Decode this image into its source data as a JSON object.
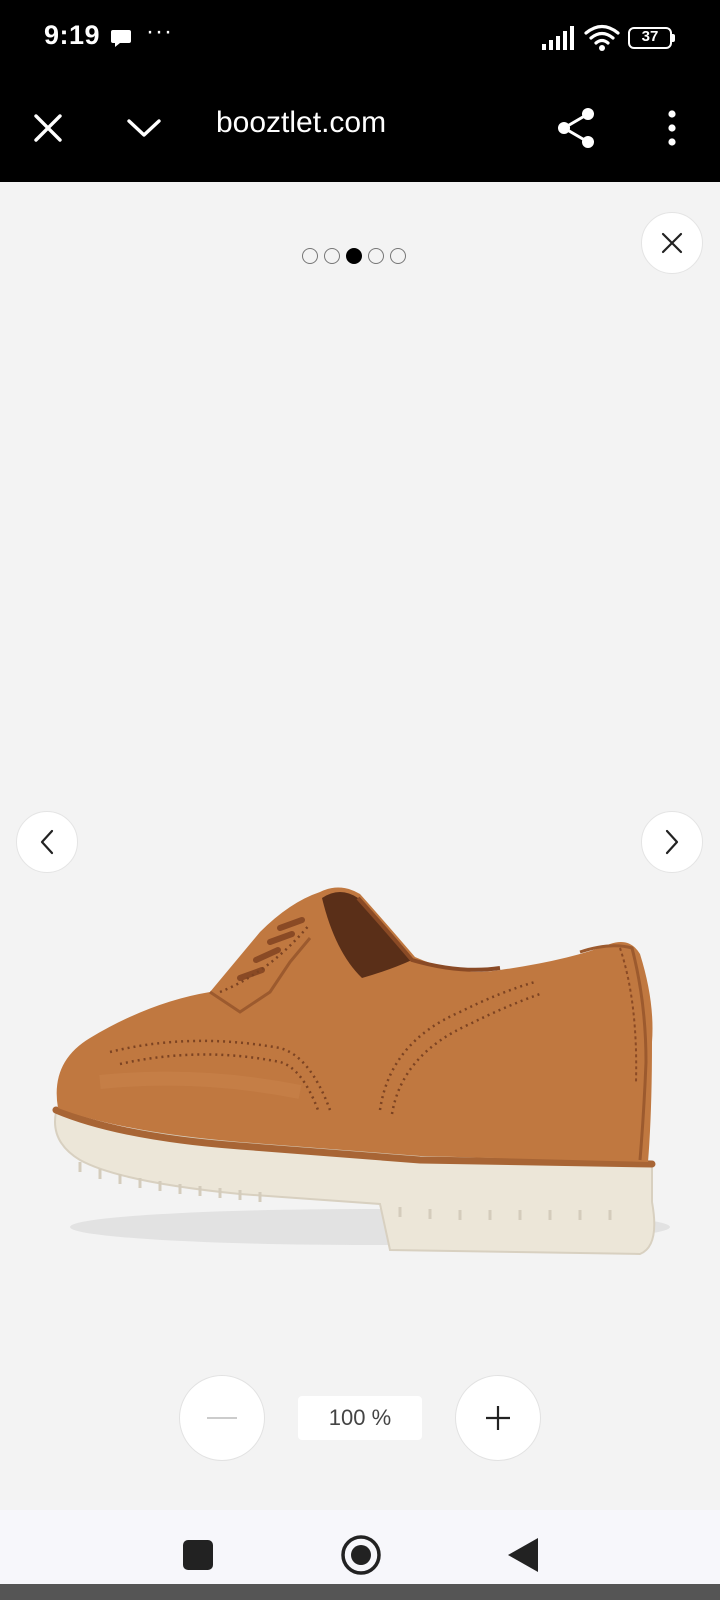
{
  "status_bar": {
    "time": "9:19",
    "more": "···",
    "battery": "37"
  },
  "toolbar": {
    "url": "booztlet.com"
  },
  "gallery": {
    "image_count": 5,
    "active_index": 2,
    "image_alt": "Brown nubuck lace-up wingtip shoe with white lug sole"
  },
  "zoom": {
    "level": "100 %"
  },
  "colors": {
    "toolbar_bg": "#000000",
    "viewer_bg": "#f3f3f3",
    "shoe_leather": "#c07840",
    "sole": "#ece6d8"
  }
}
